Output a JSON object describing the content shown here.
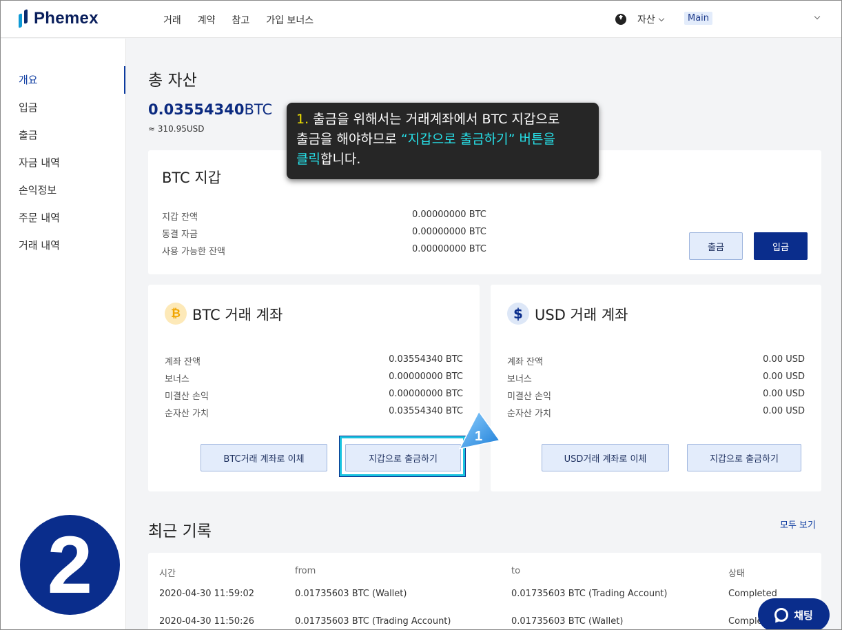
{
  "header": {
    "logo": "Phemex",
    "nav": [
      "거래",
      "계약",
      "참고",
      "가입 보너스"
    ],
    "asset_menu": "자산",
    "account": "Main"
  },
  "sidebar": {
    "items": [
      "개요",
      "입금",
      "출금",
      "자금 내역",
      "손익정보",
      "주문 내역",
      "거래 내역"
    ]
  },
  "summary": {
    "title": "총 자산",
    "amount": "0.03554340",
    "unit": "BTC",
    "usd": "≈ 310.95USD"
  },
  "btc_wallet": {
    "title": "BTC 지갑",
    "rows": [
      {
        "label": "지갑 잔액",
        "value": "0.00000000 BTC"
      },
      {
        "label": "동결 자금",
        "value": "0.00000000 BTC"
      },
      {
        "label": "사용 가능한 잔액",
        "value": "0.00000000 BTC"
      }
    ],
    "withdraw_label": "출금",
    "deposit_label": "입금"
  },
  "btc_trading": {
    "icon": "bitcoin-icon",
    "title": "BTC 거래 계좌",
    "rows": [
      {
        "label": "계좌 잔액",
        "value": "0.03554340 BTC"
      },
      {
        "label": "보너스",
        "value": "0.00000000 BTC"
      },
      {
        "label": "미결산 손익",
        "value": "0.00000000 BTC"
      },
      {
        "label": "순자산 가치",
        "value": "0.03554340 BTC"
      }
    ],
    "transfer_label": "BTC거래 계좌로 이체",
    "to_wallet_label": "지갑으로 출금하기"
  },
  "usd_trading": {
    "icon": "dollar-icon",
    "title": "USD 거래 계좌",
    "rows": [
      {
        "label": "계좌 잔액",
        "value": "0.00 USD"
      },
      {
        "label": "보너스",
        "value": "0.00 USD"
      },
      {
        "label": "미결산 손익",
        "value": "0.00 USD"
      },
      {
        "label": "순자산 가치",
        "value": "0.00 USD"
      }
    ],
    "transfer_label": "USD거래 계좌로 이체",
    "to_wallet_label": "지갑으로 출금하기"
  },
  "tooltip": {
    "num": "1.",
    "line1": " 출금을 위해서는 거래계좌에서 BTC 지갑으로",
    "line2a": "출금을 해야하므로 ",
    "line2b": "“지갑으로 출금하기” 버튼을",
    "line3a": "클릭",
    "line3b": "합니다."
  },
  "pointer": {
    "label": "1"
  },
  "history": {
    "title": "최근 기록",
    "see_all": "모두 보기",
    "columns": [
      "시간",
      "from",
      "to",
      "상태"
    ],
    "rows": [
      {
        "time": "2020-04-30 11:59:02",
        "from": "0.01735603 BTC (Wallet)",
        "to": "0.01735603 BTC (Trading Account)",
        "status": "Completed"
      },
      {
        "time": "2020-04-30 11:50:26",
        "from": "0.01735603 BTC (Trading Account)",
        "to": "0.01735603 BTC (Wallet)",
        "status": "Completed"
      }
    ]
  },
  "step_badge": "2",
  "chat": {
    "label": "채팅"
  },
  "colors": {
    "brand": "#0a2d8c",
    "highlight": "#19c3e0",
    "tooltip_bg": "#262626"
  }
}
